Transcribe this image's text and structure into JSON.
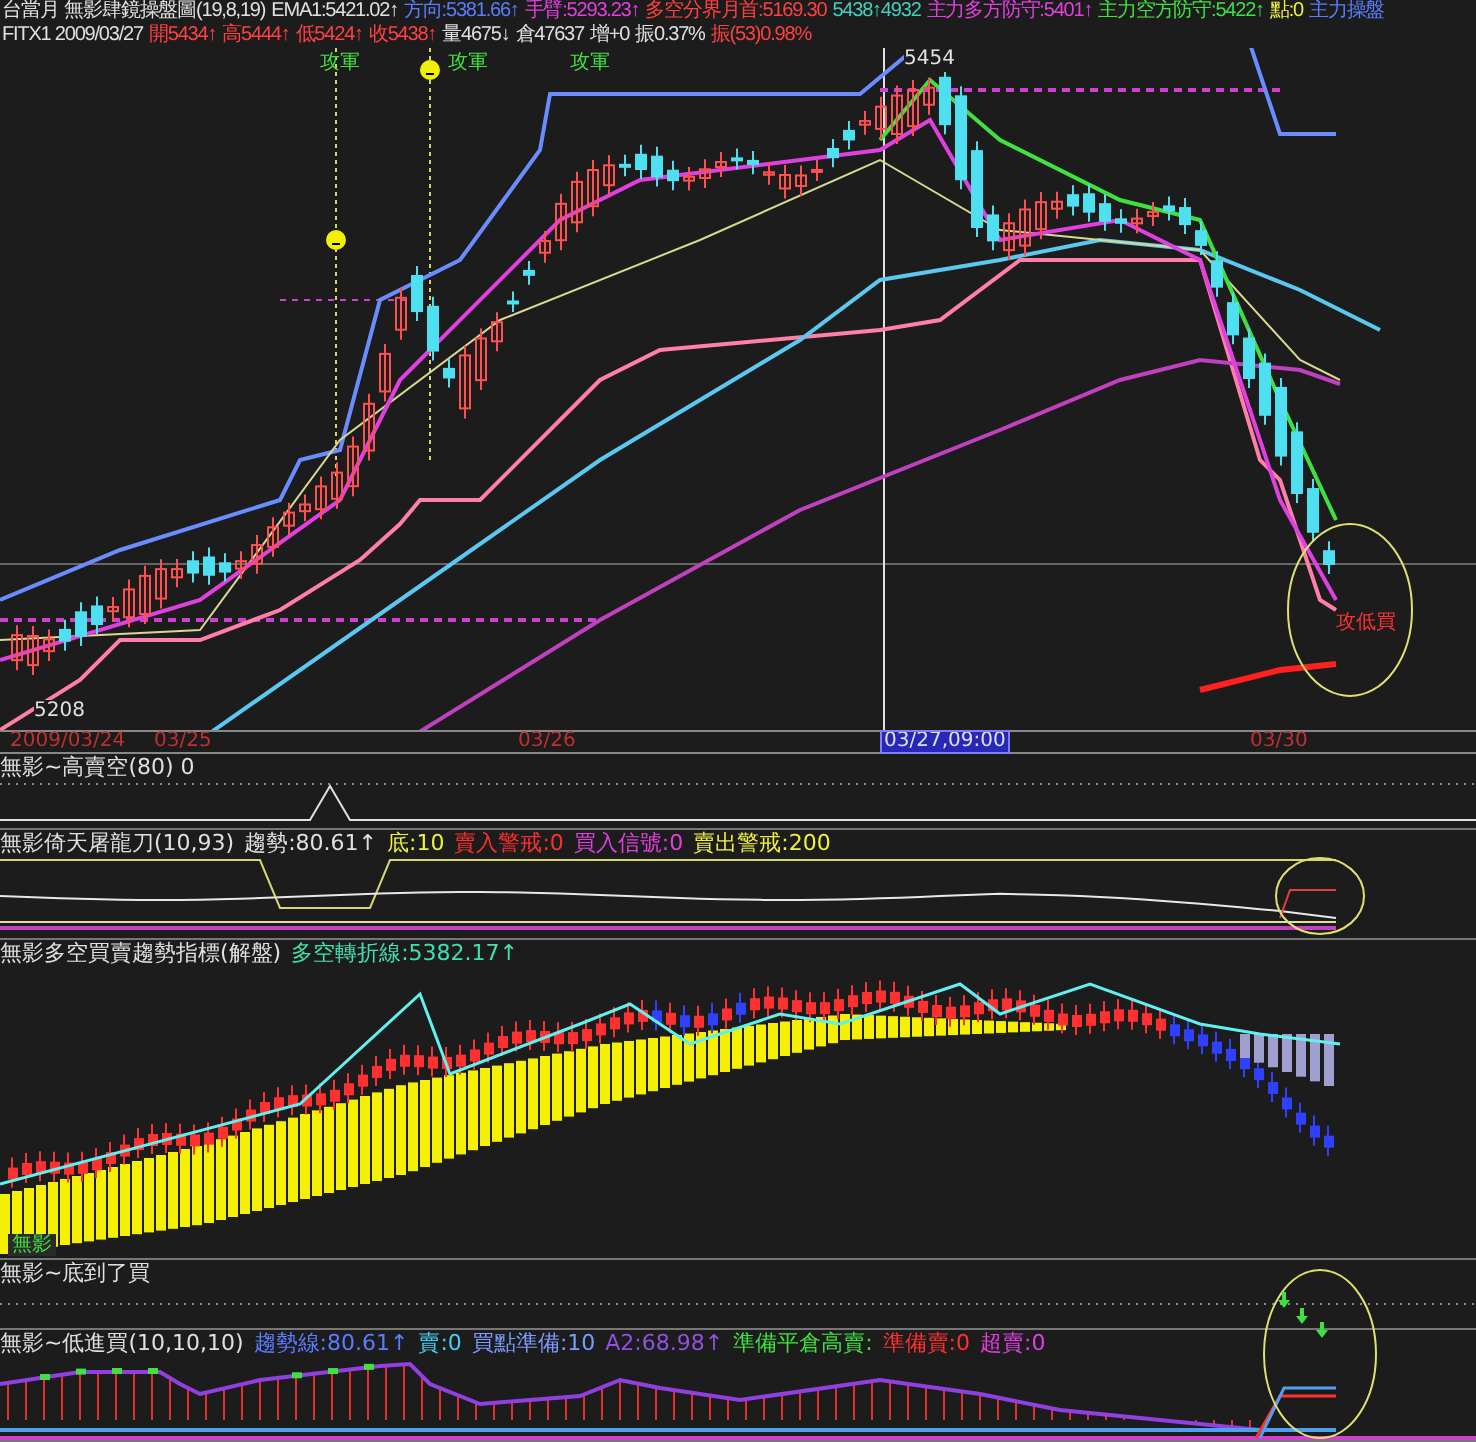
{
  "header_rows": [
    {
      "parts": [
        {
          "text": "台當月",
          "color": "#e0e0e0"
        },
        {
          "text": "無影肆鏡操盤圖(19,8,19)",
          "color": "#e0e0e0"
        },
        {
          "text": "EMA1:5421.02↑",
          "color": "#e0e0e0"
        },
        {
          "text": "方向:5381.66↑",
          "color": "#5a7cff"
        },
        {
          "text": "手臂:5293.23↑",
          "color": "#e040e0"
        },
        {
          "text": "多空分界月首:5169.30",
          "color": "#ff4040"
        },
        {
          "text": "5438↑4932",
          "color": "#40d0c0"
        },
        {
          "text": "主力多方防守:5401↑",
          "color": "#e040e0"
        },
        {
          "text": "主力空方防守:5422↑",
          "color": "#40e040"
        },
        {
          "text": "點:0",
          "color": "#f0f040"
        },
        {
          "text": "主力操盤",
          "color": "#5a7cff"
        }
      ]
    },
    {
      "parts": [
        {
          "text": "FITX1 2009/03/27",
          "color": "#e0e0e0"
        },
        {
          "text": "開5434↑",
          "color": "#ff4040"
        },
        {
          "text": "高5444↑",
          "color": "#ff4040"
        },
        {
          "text": "低5424↑",
          "color": "#ff4040"
        },
        {
          "text": "收5438↑",
          "color": "#ff4040"
        },
        {
          "text": "量4675↓",
          "color": "#e0e0e0"
        },
        {
          "text": "倉47637",
          "color": "#e0e0e0"
        },
        {
          "text": "增+0",
          "color": "#e0e0e0"
        },
        {
          "text": "振0.37%",
          "color": "#e0e0e0"
        },
        {
          "text": "振(53)0.98%",
          "color": "#ff4040"
        }
      ]
    }
  ],
  "main_chart": {
    "signals": [
      "攻軍",
      "攻軍",
      "攻軍"
    ],
    "price_labels": [
      "5454",
      "5208"
    ],
    "buy_label": "攻低買"
  },
  "date_axis": [
    {
      "text": "2009/03/24",
      "highlighted": false
    },
    {
      "text": "03/25",
      "highlighted": false
    },
    {
      "text": "03/26",
      "highlighted": false
    },
    {
      "text": "03/27,09:00",
      "highlighted": true
    },
    {
      "text": "03/30",
      "highlighted": false
    }
  ],
  "indicators": [
    {
      "kind": "spike",
      "parts": [
        {
          "text": "無影~高賣空(80) 0",
          "color": "#e0e0e0"
        }
      ]
    },
    {
      "kind": "blade",
      "parts": [
        {
          "text": "無影倚天屠龍刀(10,93)",
          "color": "#e0e0e0"
        },
        {
          "text": "趨勢:80.61↑",
          "color": "#e0e0e0"
        },
        {
          "text": "底:10",
          "color": "#f0f040"
        },
        {
          "text": "賣入警戒:0",
          "color": "#ff3030"
        },
        {
          "text": "買入信號:0",
          "color": "#e040e0"
        },
        {
          "text": "賣出警戒:200",
          "color": "#f0f040"
        }
      ]
    },
    {
      "kind": "trend",
      "parts": [
        {
          "text": "無影多空買賣趨勢指標(解盤)",
          "color": "#e0e0e0"
        },
        {
          "text": "多空轉折線:5382.17↑",
          "color": "#40e0b0"
        }
      ],
      "tag": "無影"
    },
    {
      "kind": "bottom",
      "parts": [
        {
          "text": "無影~底到了買",
          "color": "#e0e0e0"
        }
      ]
    },
    {
      "kind": "low",
      "parts": [
        {
          "text": "無影~低進買(10,10,10)",
          "color": "#e0e0e0"
        },
        {
          "text": "趨勢線:80.61↑",
          "color": "#5a7cff"
        },
        {
          "text": "賣:0",
          "color": "#40d0f0"
        },
        {
          "text": "買點準備:10",
          "color": "#7a9cff"
        },
        {
          "text": "A2:68.98↑",
          "color": "#9050e0"
        },
        {
          "text": "準備平倉高賣:",
          "color": "#40e040"
        },
        {
          "text": "準備賣:0",
          "color": "#ff3030"
        },
        {
          "text": "超賣:0",
          "color": "#e040e0"
        }
      ]
    }
  ]
}
